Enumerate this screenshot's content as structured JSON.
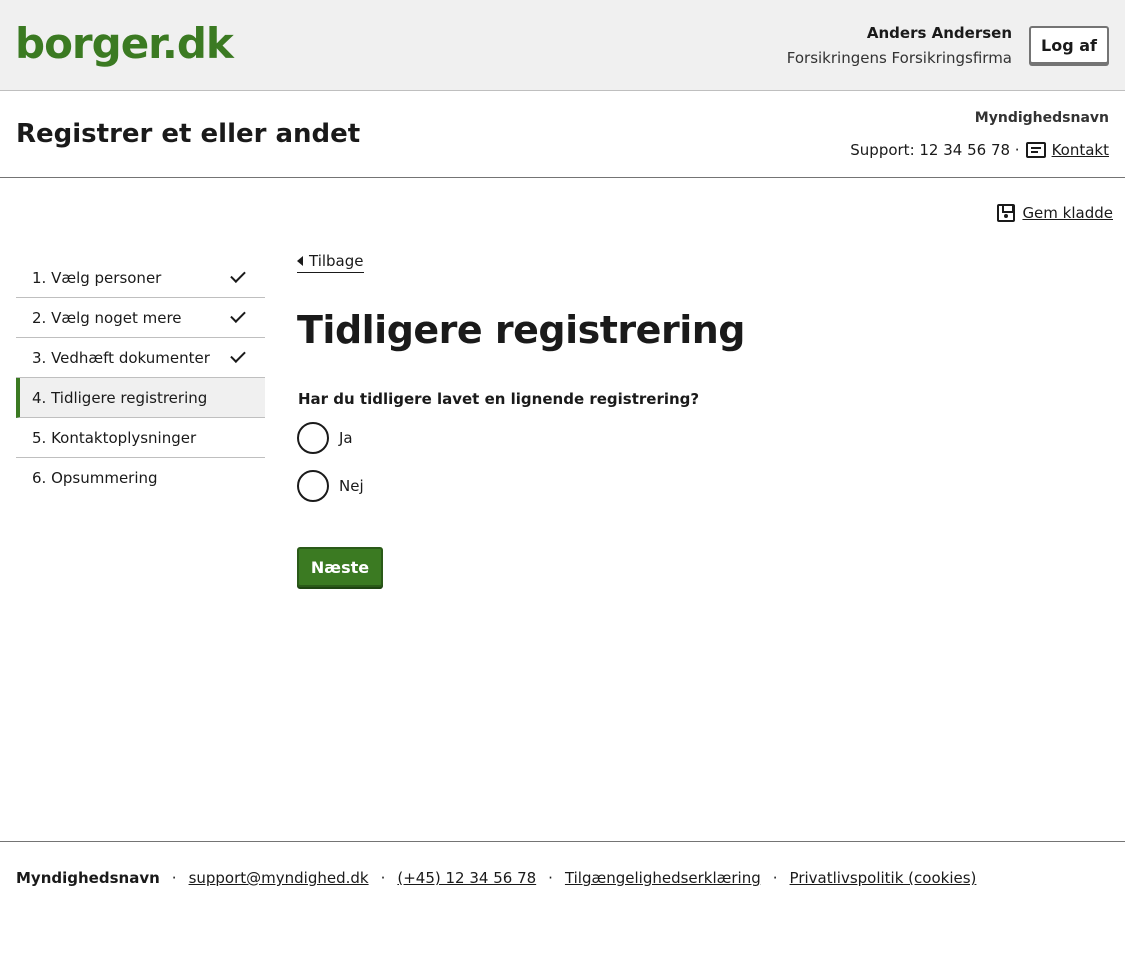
{
  "topbar": {
    "logo": "borger.dk",
    "user_name": "Anders Andersen",
    "user_org": "Forsikringens Forsikringsfirma",
    "logout_label": "Log af"
  },
  "header": {
    "title": "Registrer et eller andet",
    "authority": "Myndighedsnavn",
    "support_text": "Support: 12 34 56 78 ·",
    "contact_label": "Kontakt"
  },
  "save_draft_label": "Gem kladde",
  "steps": [
    {
      "label": "1. Vælg personer",
      "completed": true
    },
    {
      "label": "2. Vælg noget mere",
      "completed": true
    },
    {
      "label": "3. Vedhæft dokumenter",
      "completed": true
    },
    {
      "label": "4. Tidligere registrering",
      "completed": false,
      "active": true
    },
    {
      "label": "5. Kontaktoplysninger",
      "completed": false
    },
    {
      "label": "6. Opsummering",
      "completed": false
    }
  ],
  "main": {
    "back_label": "Tilbage",
    "title": "Tidligere registrering",
    "question": "Har du tidligere lavet en lignende registrering?",
    "options": [
      "Ja",
      "Nej"
    ],
    "next_label": "Næste"
  },
  "footer": {
    "authority": "Myndighedsnavn",
    "email": "support@myndighed.dk",
    "phone": "(+45) 12 34 56 78",
    "accessibility": "Tilgængelighedserklæring",
    "privacy": "Privatlivspolitik (cookies)"
  },
  "colors": {
    "brand_green": "#3b7a22",
    "topbar_bg": "#f0f0f0"
  }
}
